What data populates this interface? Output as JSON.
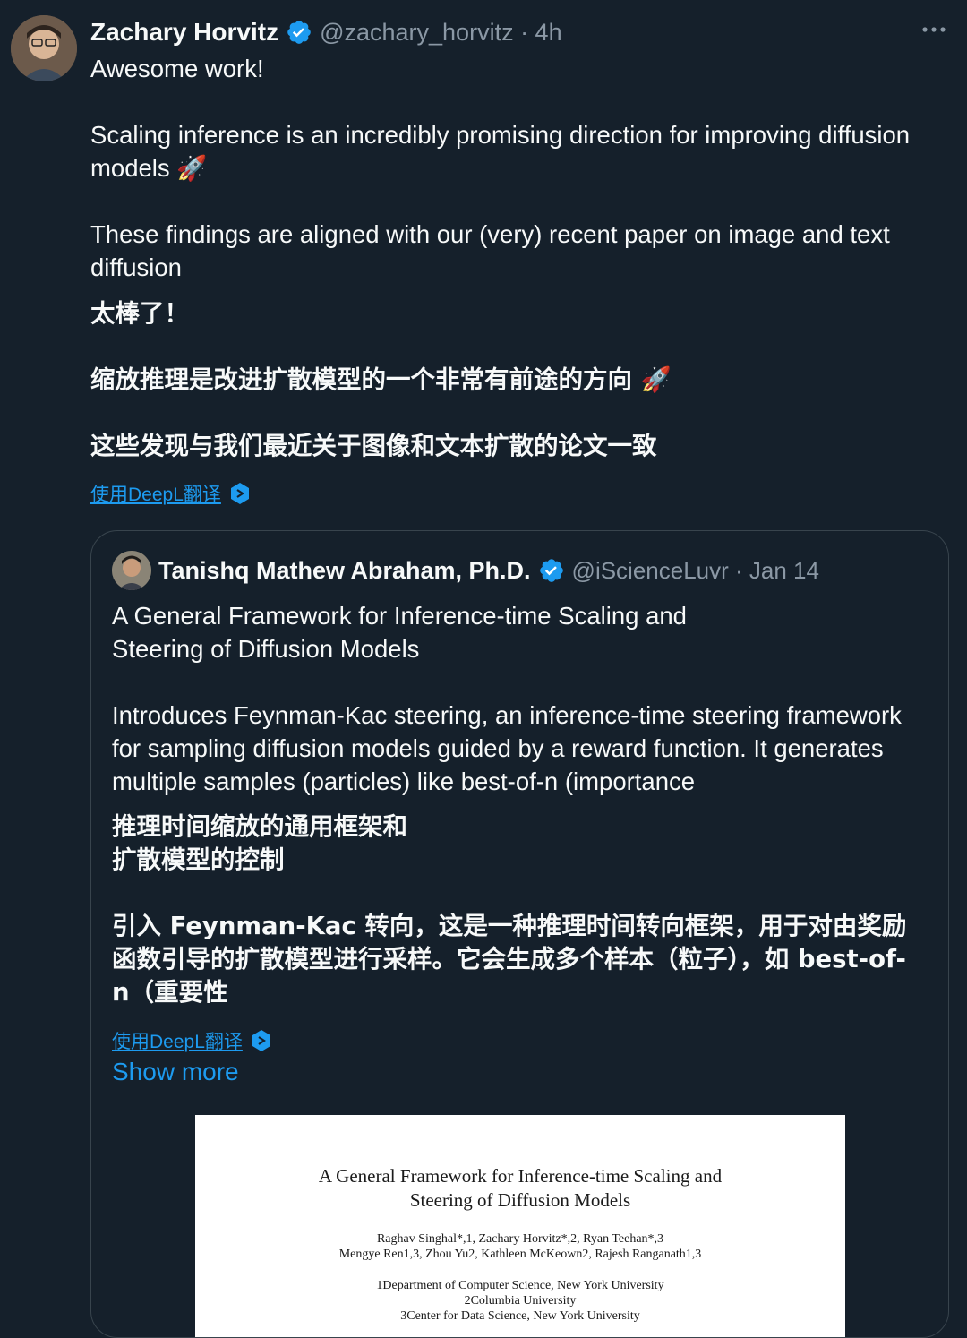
{
  "tweet": {
    "author_name": "Zachary Horvitz",
    "handle_meta": "@zachary_horvitz · 4h",
    "text": "Awesome work!\n\nScaling inference is an incredibly promising direction for improving diffusion models 🚀\n\nThese findings are aligned with our (very) recent paper on image and text diffusion",
    "translation": "太棒了！\n\n缩放推理是改进扩散模型的一个非常有前途的方向 🚀\n\n这些发现与我们最近关于图像和文本扩散的论文一致",
    "translate_link": "使用DeepL翻译"
  },
  "quote": {
    "author_name": "Tanishq Mathew Abraham, Ph.D.",
    "handle_meta": "@iScienceLuvr · Jan 14",
    "text": "A General Framework for Inference-time Scaling and\nSteering of Diffusion Models\n\nIntroduces Feynman-Kac steering, an inference-time steering framework for sampling diffusion models guided by a reward function. It generates multiple samples (particles) like best-of-n (importance",
    "translation": "推理时间缩放的通用框架和\n扩散模型的控制\n\n引入 Feynman-Kac 转向，这是一种推理时间转向框架，用于对由奖励函数引导的扩散模型进行采样。它会生成多个样本（粒子），如 best-of-n（重要性",
    "translate_link": "使用DeepL翻译",
    "show_more": "Show more"
  },
  "paper": {
    "title_line1": "A General Framework for Inference-time Scaling and",
    "title_line2": "Steering of Diffusion Models",
    "authors_line1": "Raghav Singhal*,1, Zachary Horvitz*,2, Ryan Teehan*,3",
    "authors_line2": "Mengye Ren1,3, Zhou Yu2, Kathleen McKeown2, Rajesh Ranganath1,3",
    "affil1": "1Department of Computer Science, New York University",
    "affil2": "2Columbia University",
    "affil3": "3Center for Data Science, New York University"
  },
  "colors": {
    "background": "#15202b",
    "link": "#1d9bf0",
    "muted": "#8b98a5",
    "verified": "#1d9bf0"
  },
  "icons": [
    "avatar",
    "verified-badge-icon",
    "more-options-icon",
    "deepl-icon"
  ]
}
